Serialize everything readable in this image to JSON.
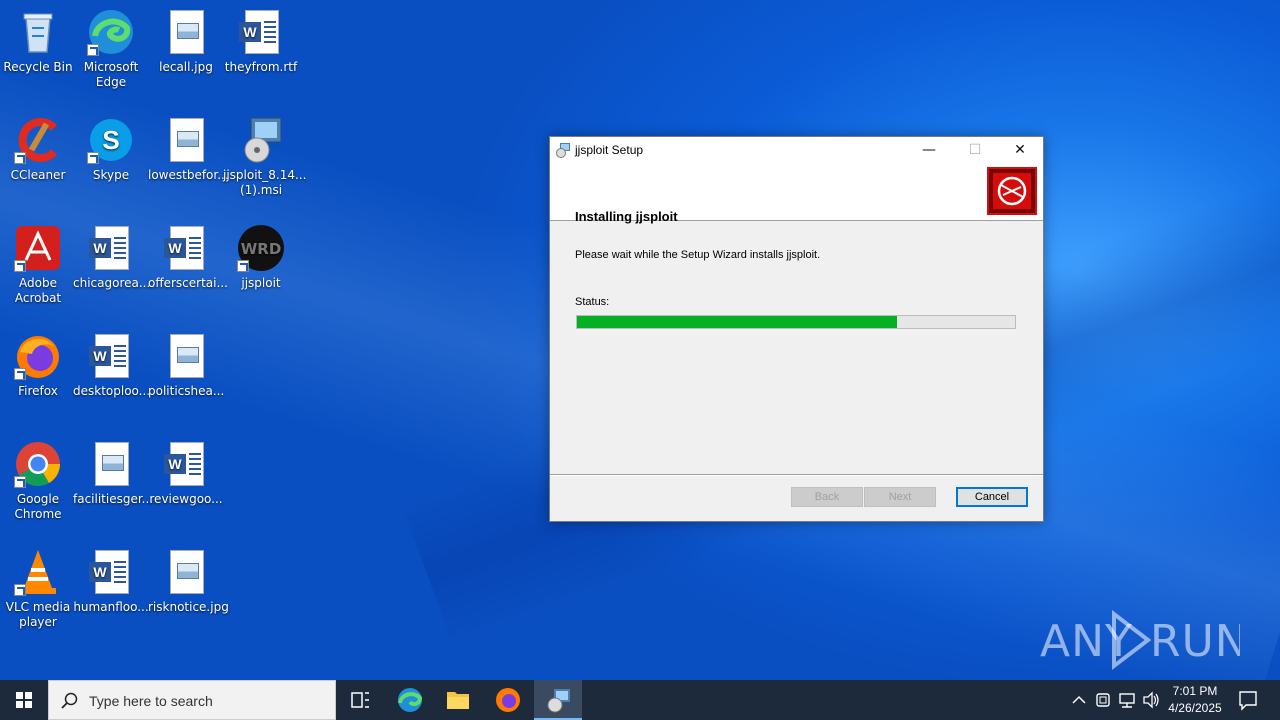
{
  "desktop": {
    "icons": [
      {
        "label": "Recycle Bin",
        "icon": "recycle-bin-icon"
      },
      {
        "label": "Microsoft Edge",
        "icon": "edge-icon"
      },
      {
        "label": "lecall.jpg",
        "icon": "image-file-icon"
      },
      {
        "label": "theyfrom.rtf",
        "icon": "word-file-icon"
      },
      {
        "label": "CCleaner",
        "icon": "ccleaner-icon"
      },
      {
        "label": "Skype",
        "icon": "skype-icon"
      },
      {
        "label": "lowestbefor...",
        "icon": "image-file-icon"
      },
      {
        "label": "jjsploit_8.14...(1).msi",
        "icon": "msi-installer-icon"
      },
      {
        "label": "Adobe Acrobat",
        "icon": "acrobat-icon"
      },
      {
        "label": "chicagorea...",
        "icon": "word-file-icon"
      },
      {
        "label": "offerscertai...",
        "icon": "word-file-icon"
      },
      {
        "label": "jjsploit",
        "icon": "jjsploit-icon"
      },
      {
        "label": "Firefox",
        "icon": "firefox-icon"
      },
      {
        "label": "desktoploo...",
        "icon": "word-file-icon"
      },
      {
        "label": "politicshea...",
        "icon": "image-file-icon"
      },
      {
        "label": "Google Chrome",
        "icon": "chrome-icon"
      },
      {
        "label": "facilitiesger...",
        "icon": "image-file-icon"
      },
      {
        "label": "reviewgoo...",
        "icon": "word-file-icon"
      },
      {
        "label": "VLC media player",
        "icon": "vlc-icon"
      },
      {
        "label": "humanfloo...",
        "icon": "word-file-icon"
      },
      {
        "label": "risknotice.jpg",
        "icon": "image-file-icon"
      }
    ]
  },
  "dialog": {
    "title": "jjsploit Setup",
    "heading": "Installing jjsploit",
    "message": "Please wait while the Setup Wizard installs jjsploit.",
    "status_label": "Status:",
    "progress_fraction": 0.73,
    "buttons": {
      "back": "Back",
      "next": "Next",
      "cancel": "Cancel"
    },
    "controls": {
      "minimize": "—",
      "maximize": "☐",
      "close": "✕"
    }
  },
  "taskbar": {
    "search_placeholder": "Type here to search",
    "time": "7:01 PM",
    "date": "4/26/2025"
  },
  "watermark": "ANY RUN",
  "colors": {
    "progress": "#06b025",
    "taskbar": "#1c2a3c",
    "accent": "#0078d7"
  }
}
